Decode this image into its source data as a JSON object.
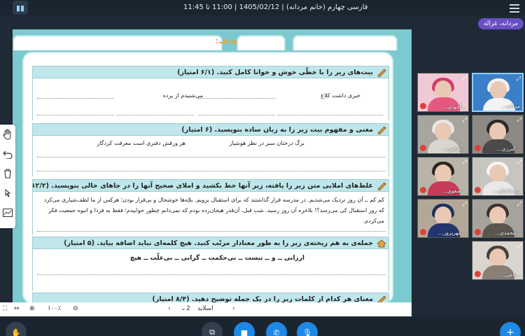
{
  "topbar": {
    "session": "فارسی چهارم (خانم مردانه) | 1405/02/12 | 11:00 تا 11:45"
  },
  "user_badge": "مردانه، غزاله",
  "slide": {
    "goal_label": "هدف:",
    "sections": [
      {
        "title": "بیت‌های زیر را با خطّی خوش و خوانا کامل کنید. (۶/۱ امتیاز)",
        "verses": [
          "خبری داشت کلاغ",
          "می‌شنیدم از پرده"
        ]
      },
      {
        "title": "معنی و مفهوم بیت زیر را به زبان ساده بنویسید. (۶ امتیاز)",
        "verses": [
          "برگ درختان سبز در نظر هوشیار",
          "هر ورقش دفتری است معرفت کردگار"
        ]
      },
      {
        "title": "غلط‌های املایی متن زیر را یافته، زیر آنها خط بکشید و املای صحیح آنها را در جاهای خالی بنویسید. (۱۲/۲ امتیاز)",
        "para": "کم کم ــ آن روز نزدیک می‌شدیم. در مدرسه قرار گذاشتند که برای استقبال برویم. بچّه‌ها خوشحال و بی‌قرار بودن؛ هرکس از ما لطف‌شیاری می‌کرد که روز استقبال کی می‌رسد؟! بلاخره آن روز رسید. شب قبل، آن‌قدر هیجان‌زده بودم که نمی‌دانم چطور خوابیدم؛ فقط به فردا و انبوه جمعیت فکر می‌کردم."
      },
      {
        "title": "جمله‌ی به هم ریخته‌ی زیر را به طور معنادار مرتّب کنید. هیچ کلمه‌ای نباید اضافه بیاید. (۵ امتیاز)",
        "words": "ارزانی ــ و ــ نیست ــ بی‌حکمت ــ گرانی ــ بی‌علّت ــ هیچ"
      },
      {
        "title": "معنای هر کدام از کلمات زیر را در یک جمله توضیح دهید. (۸/۴ امتیاز)"
      }
    ]
  },
  "bottomnav": {
    "zoom": "۱۰۰٪",
    "slide_label": "اسلاید",
    "slide_number": "2"
  },
  "participants": [
    {
      "name": "...آجودی...",
      "mic": true
    },
    {
      "name": "مردانه...",
      "mic": false
    },
    {
      "name": "...ترکمن...",
      "mic": true
    },
    {
      "name": "...البرزی...",
      "mic": true
    },
    {
      "name": "...صفوی...",
      "mic": true
    },
    {
      "name": "...صادقیان...",
      "mic": true
    },
    {
      "name": "...مهرپرور...",
      "mic": true
    },
    {
      "name": "...محمدی...",
      "mic": true
    },
    {
      "name": "...ناجی...",
      "mic": true
    }
  ]
}
